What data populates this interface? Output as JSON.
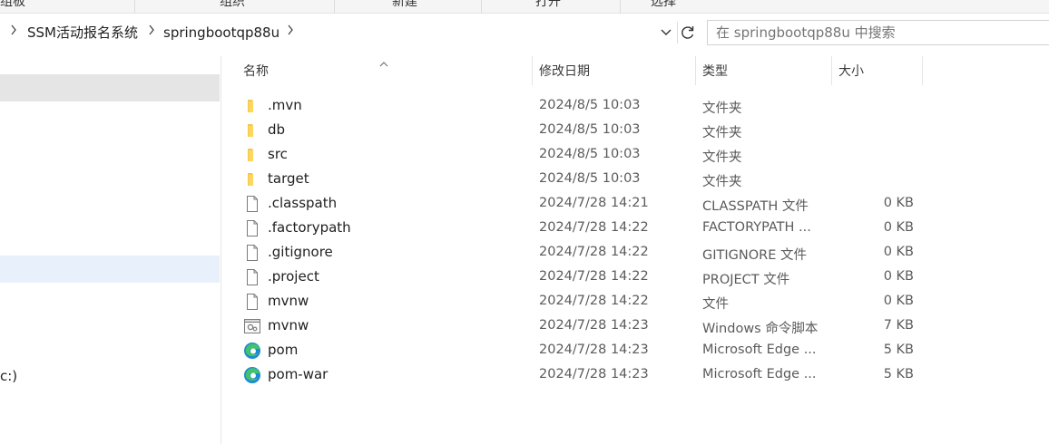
{
  "ribbon": {
    "groups": [
      "组板",
      "组织",
      "新建",
      "打开",
      "选择"
    ]
  },
  "address": {
    "crumbs": [
      "SSM活动报名系统",
      "springbootqp88u"
    ]
  },
  "search": {
    "placeholder": "在 springbootqp88u 中搜索"
  },
  "sidebar": {
    "partial_text": "c:)"
  },
  "columns": [
    "名称",
    "修改日期",
    "类型",
    "大小"
  ],
  "files": [
    {
      "name": ".mvn",
      "date": "2024/8/5 10:03",
      "type": "文件夹",
      "size": "",
      "icon": "folder-icon"
    },
    {
      "name": "db",
      "date": "2024/8/5 10:03",
      "type": "文件夹",
      "size": "",
      "icon": "folder-icon"
    },
    {
      "name": "src",
      "date": "2024/8/5 10:03",
      "type": "文件夹",
      "size": "",
      "icon": "folder-icon"
    },
    {
      "name": "target",
      "date": "2024/8/5 10:03",
      "type": "文件夹",
      "size": "",
      "icon": "folder-icon"
    },
    {
      "name": ".classpath",
      "date": "2024/7/28 14:21",
      "type": "CLASSPATH 文件",
      "size": "0 KB",
      "icon": "file-icon"
    },
    {
      "name": ".factorypath",
      "date": "2024/7/28 14:22",
      "type": "FACTORYPATH ...",
      "size": "0 KB",
      "icon": "file-icon"
    },
    {
      "name": ".gitignore",
      "date": "2024/7/28 14:22",
      "type": "GITIGNORE 文件",
      "size": "0 KB",
      "icon": "file-icon"
    },
    {
      "name": ".project",
      "date": "2024/7/28 14:22",
      "type": "PROJECT 文件",
      "size": "0 KB",
      "icon": "file-icon"
    },
    {
      "name": "mvnw",
      "date": "2024/7/28 14:22",
      "type": "文件",
      "size": "0 KB",
      "icon": "file-icon"
    },
    {
      "name": "mvnw",
      "date": "2024/7/28 14:23",
      "type": "Windows 命令脚本",
      "size": "7 KB",
      "icon": "script-icon"
    },
    {
      "name": "pom",
      "date": "2024/7/28 14:23",
      "type": "Microsoft Edge ...",
      "size": "5 KB",
      "icon": "edge-icon"
    },
    {
      "name": "pom-war",
      "date": "2024/7/28 14:23",
      "type": "Microsoft Edge ...",
      "size": "5 KB",
      "icon": "edge-icon"
    }
  ]
}
